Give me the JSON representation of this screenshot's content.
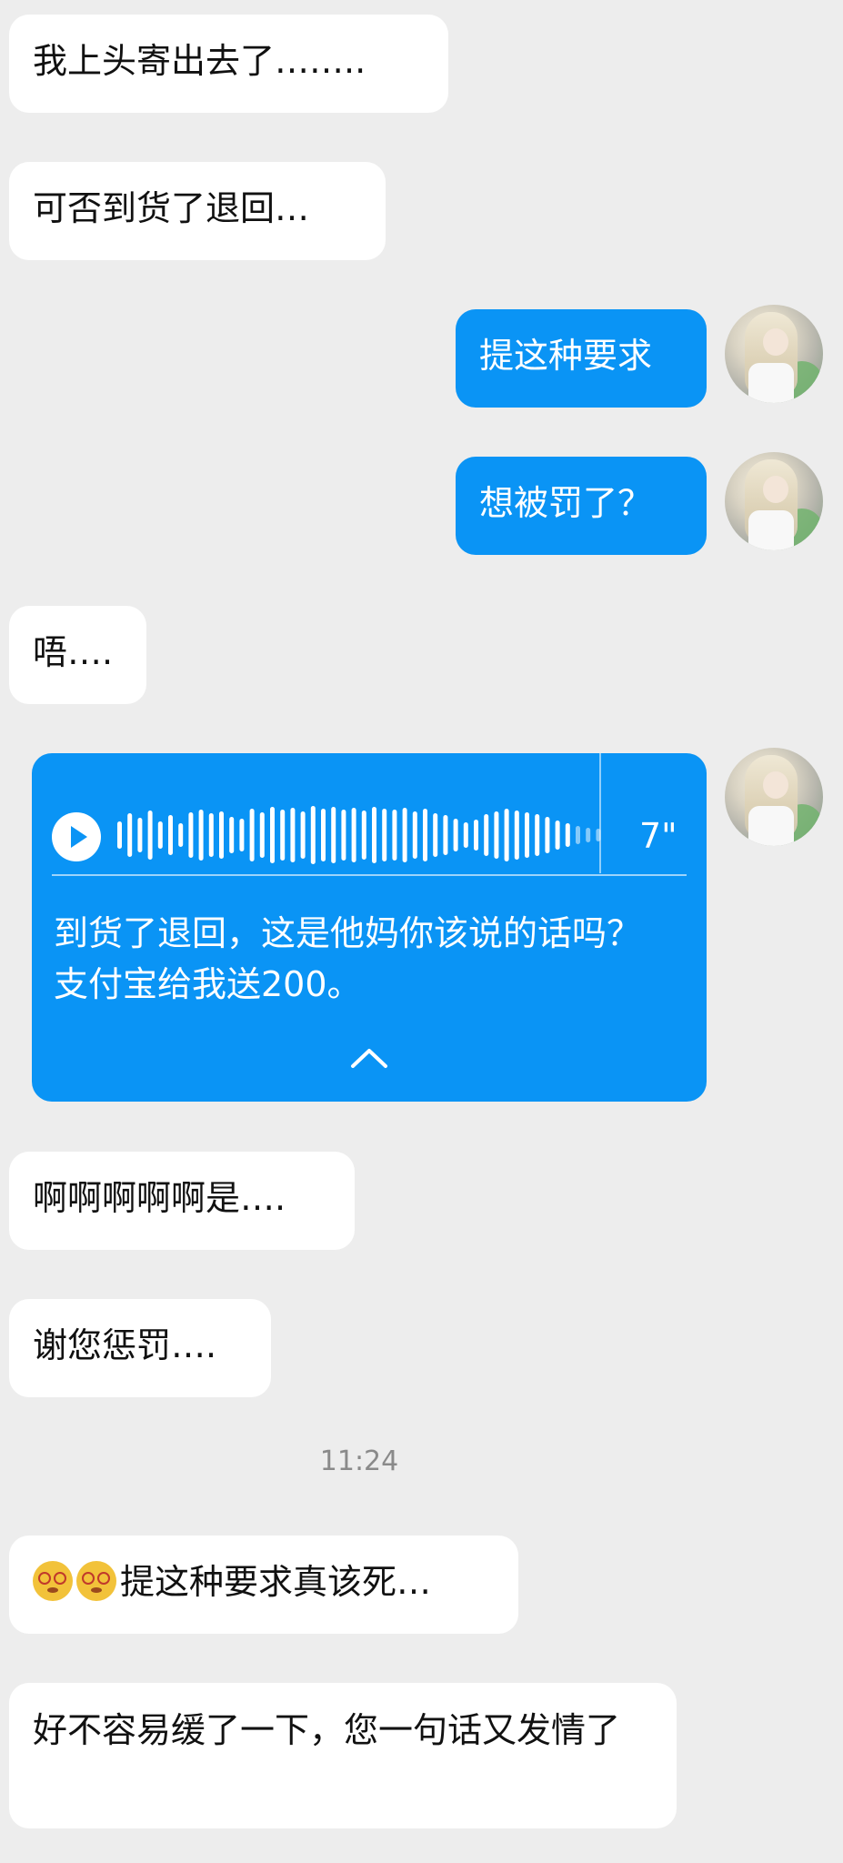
{
  "messages": {
    "m1": "我上头寄出去了……..",
    "m2": "可否到货了退回…",
    "m3": "提这种要求",
    "m4": "想被罚了？",
    "m5": "唔….",
    "m7": "啊啊啊啊啊是….",
    "m8": "谢您惩罚….",
    "m9": "提这种要求真该死…",
    "m10": "好不容易缓了一下，您一句话又发情了"
  },
  "voice_message": {
    "duration": "7\"",
    "transcript": "到货了退回，这是他妈你该说的话吗？支付宝给我送200。",
    "collapse_icon": "chevron-up-icon",
    "play_icon": "play-icon"
  },
  "timestamp": "11:24",
  "emojis": [
    "dizzy-face-emoji",
    "dizzy-face-emoji"
  ],
  "colors": {
    "background": "#ededed",
    "incoming_bubble": "#ffffff",
    "outgoing_bubble": "#0a94f5",
    "outgoing_text": "#ffffff",
    "timestamp_text": "#8a8a8a"
  }
}
